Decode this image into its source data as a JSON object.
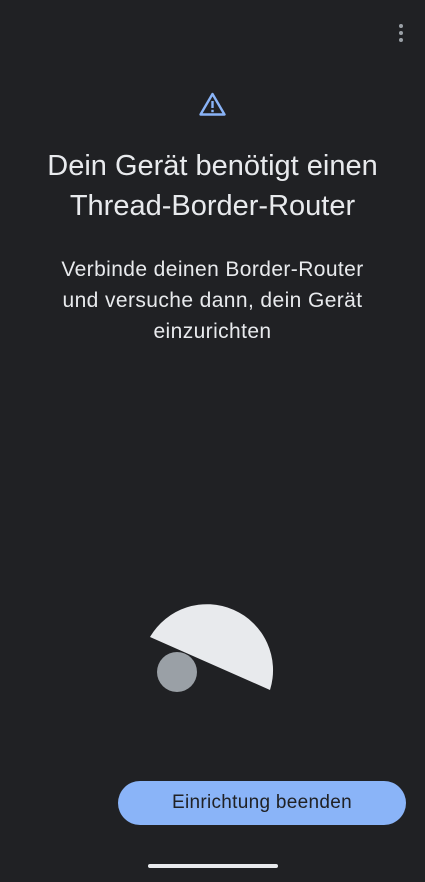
{
  "header": {
    "menu_icon": "more-vert-icon",
    "status_icon": "warning-icon",
    "accent_color": "#8ab4f8"
  },
  "main": {
    "title_line1": "Dein Gerät benötigt einen",
    "title_line2": "Thread-Border-Router",
    "subtitle_line1": "Verbinde deinen Border-Router",
    "subtitle_line2": "und versuche dann, dein Gerät",
    "subtitle_line3": "einzurichten"
  },
  "footer": {
    "finish_setup_label": "Einrichtung beenden"
  }
}
